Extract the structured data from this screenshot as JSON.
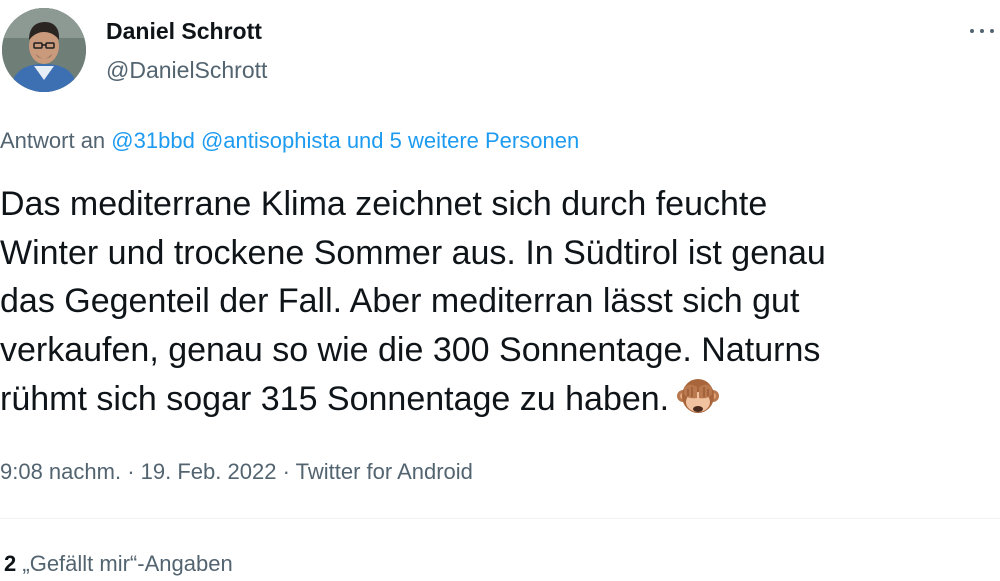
{
  "author": {
    "name": "Daniel Schrott",
    "handle": "@DanielSchrott"
  },
  "more_icon": "more-horizontal-icon",
  "reply": {
    "prefix": "Antwort an",
    "mention1": "@31bbd",
    "mention2": "@antisophista",
    "others": "und 5 weitere Personen"
  },
  "tweet": {
    "lines": [
      "Das mediterrane Klima zeichnet sich durch feuchte",
      "Winter und trockene Sommer aus. In Südtirol ist genau",
      "das Gegenteil der Fall. Aber mediterran lässt sich gut",
      "verkaufen, genau so wie die 300 Sonnentage. Naturns",
      "rühmt sich sogar 315 Sonnentage zu haben."
    ],
    "emoji": "see-no-evil-monkey"
  },
  "meta": {
    "time": "9:08 nachm.",
    "date": "19. Feb. 2022",
    "source": "Twitter for Android",
    "separator": "·"
  },
  "likes": {
    "count": "2",
    "label": "„Gefällt mir“-Angaben"
  },
  "colors": {
    "text": "#0f1419",
    "secondary": "#536471",
    "link": "#1d9bf0",
    "divider": "#eff3f4"
  }
}
